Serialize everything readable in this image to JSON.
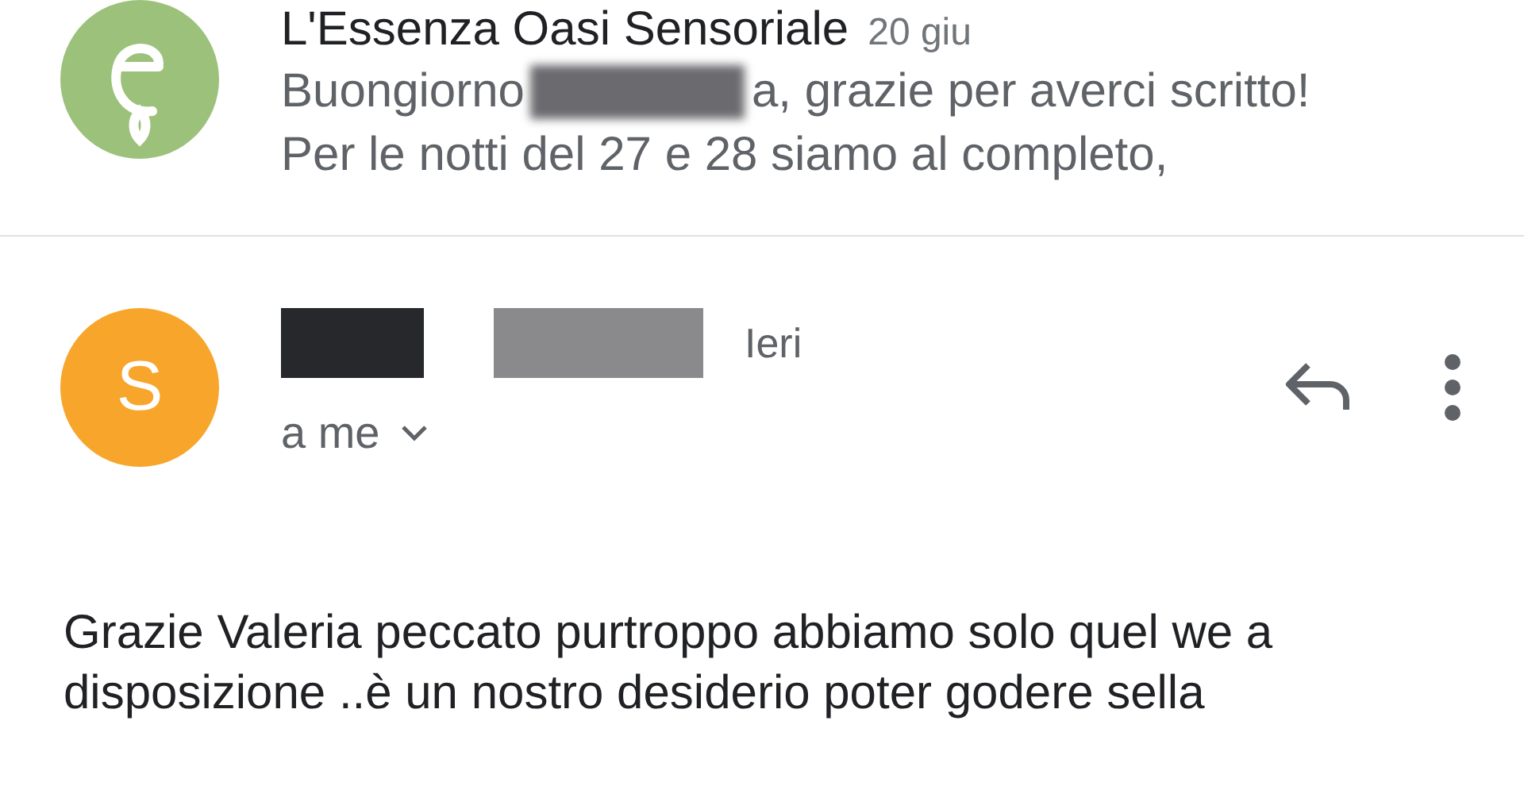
{
  "thread": [
    {
      "kind": "collapsed",
      "avatar": {
        "kind": "logo",
        "color": "#9cc17b"
      },
      "sender": "L'Essenza Oasi Sensoriale",
      "date": "20 giu",
      "snippet_start": "Buongiorno",
      "snippet_end": "a, grazie per averci scritto!",
      "snippet_line2": "Per le notti del 27 e 28 siamo al completo,"
    },
    {
      "kind": "expanded",
      "avatar": {
        "kind": "letter",
        "letter": "S",
        "color": "#f7a62b"
      },
      "date": "Ieri",
      "recipient": "a me",
      "body": [
        "Grazie Valeria peccato purtroppo abbiamo solo quel we a",
        "disposizione ..è un nostro desiderio poter godere sella"
      ]
    }
  ]
}
